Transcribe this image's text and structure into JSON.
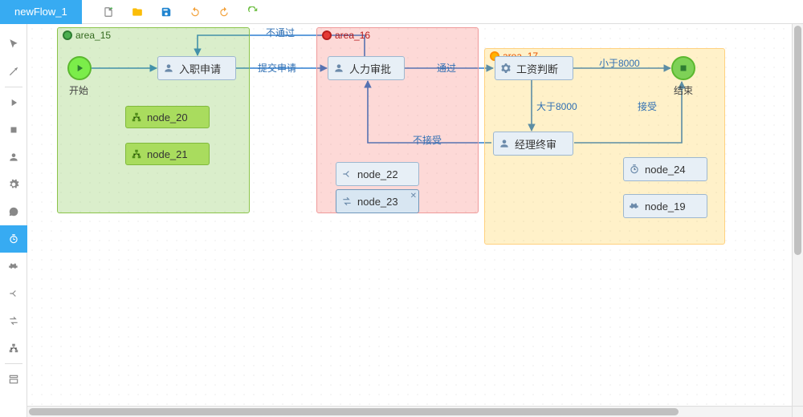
{
  "tab_title": "newFlow_1",
  "toolbar": {
    "new": "new-file",
    "open": "open",
    "save": "save",
    "undo": "undo",
    "redo": "redo",
    "refresh": "refresh"
  },
  "areas": {
    "a15": {
      "label": "area_15"
    },
    "a16": {
      "label": "area_16"
    },
    "a17": {
      "label": "area_17"
    }
  },
  "circles": {
    "start": {
      "label": "开始"
    },
    "end": {
      "label": "结束"
    }
  },
  "nodes": {
    "apply": {
      "label": "入职申请"
    },
    "hr": {
      "label": "人力审批"
    },
    "salary": {
      "label": "工资判断"
    },
    "mgr": {
      "label": "经理终审"
    },
    "n20": {
      "label": "node_20"
    },
    "n21": {
      "label": "node_21"
    },
    "n22": {
      "label": "node_22"
    },
    "n23": {
      "label": "node_23"
    },
    "n24": {
      "label": "node_24"
    },
    "n19": {
      "label": "node_19"
    }
  },
  "edges": {
    "fail": "不通过",
    "submit": "提交申请",
    "pass": "通过",
    "lt8000": "小于8000",
    "gt8000": "大于8000",
    "accept": "接受",
    "reject": "不接受"
  }
}
